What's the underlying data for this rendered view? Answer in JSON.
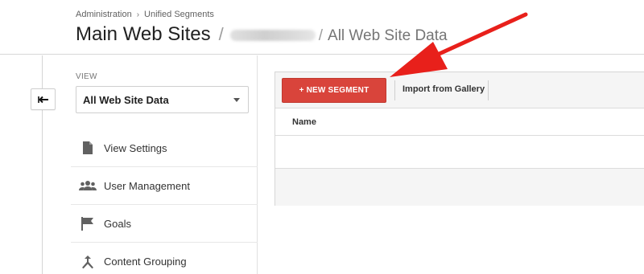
{
  "breadcrumb": {
    "items": [
      "Administration",
      "Unified Segments"
    ],
    "separator": "›"
  },
  "title": {
    "account": "Main Web Sites",
    "slash": "/",
    "property_redacted": true,
    "view": "All Web Site Data"
  },
  "sidebar": {
    "back_icon": "arrow-left-icon",
    "view_label": "VIEW",
    "view_selected": "All Web Site Data",
    "items": [
      {
        "label": "View Settings",
        "icon": "document-icon"
      },
      {
        "label": "User Management",
        "icon": "people-icon"
      },
      {
        "label": "Goals",
        "icon": "flag-icon"
      },
      {
        "label": "Content Grouping",
        "icon": "content-grouping-icon"
      }
    ]
  },
  "toolbar": {
    "new_segment_label": "+ NEW SEGMENT",
    "import_label": "Import from Gallery"
  },
  "table": {
    "columns": [
      "Name"
    ],
    "rows": []
  },
  "colors": {
    "primary_button": "#d9443b",
    "annotation_arrow": "#e8201b"
  }
}
